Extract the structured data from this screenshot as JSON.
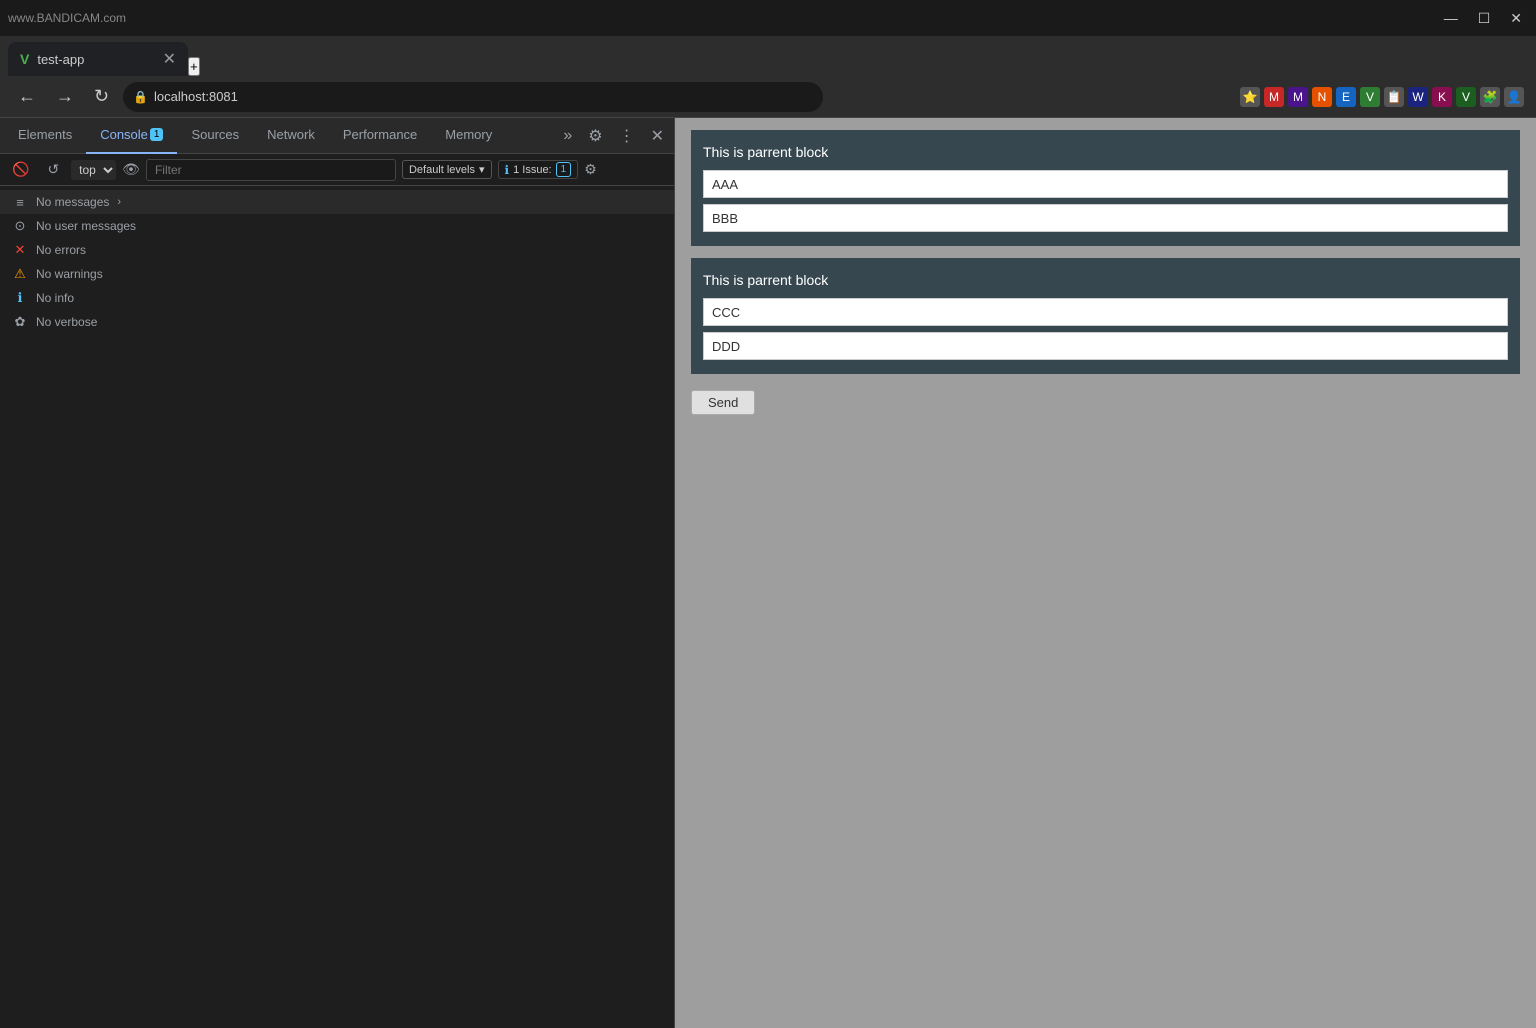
{
  "browser": {
    "tab_title": "test-app",
    "new_tab_icon": "+",
    "address": "localhost:8081",
    "window_min": "—",
    "window_max": "☐",
    "window_close": "✕"
  },
  "devtools": {
    "tabs": [
      {
        "id": "elements",
        "label": "Elements",
        "active": false
      },
      {
        "id": "console",
        "label": "Console",
        "active": true
      },
      {
        "id": "sources",
        "label": "Sources",
        "active": false
      },
      {
        "id": "network",
        "label": "Network",
        "active": false
      },
      {
        "id": "performance",
        "label": "Performance",
        "active": false
      },
      {
        "id": "memory",
        "label": "Memory",
        "active": false
      }
    ],
    "more_tabs_label": "»",
    "badge_count": "1",
    "console_toolbar": {
      "top_label": "top",
      "filter_placeholder": "Filter",
      "default_levels_label": "Default levels",
      "issue_label": "1 Issue:",
      "issue_count": "1"
    },
    "messages": [
      {
        "id": "no-messages",
        "icon": "≡",
        "icon_class": "icon-msgs",
        "text": "No messages",
        "has_arrow": true
      },
      {
        "id": "no-user-messages",
        "icon": "👤",
        "icon_class": "icon-user",
        "text": "No user messages",
        "has_arrow": false
      },
      {
        "id": "no-errors",
        "icon": "✕",
        "icon_class": "icon-error",
        "text": "No errors",
        "has_arrow": false
      },
      {
        "id": "no-warnings",
        "icon": "⚠",
        "icon_class": "icon-warn",
        "text": "No warnings",
        "has_arrow": false
      },
      {
        "id": "no-info",
        "icon": "ℹ",
        "icon_class": "icon-info",
        "text": "No info",
        "has_arrow": false
      },
      {
        "id": "no-verbose",
        "icon": "✿",
        "icon_class": "icon-verbose",
        "text": "No verbose",
        "has_arrow": false
      }
    ]
  },
  "webpage": {
    "parent_block_label": "This is parrent block",
    "block1": {
      "input1_value": "AAA",
      "input2_value": "BBB"
    },
    "block2": {
      "input1_value": "CCC",
      "input2_value": "DDD"
    },
    "send_button_label": "Send"
  }
}
